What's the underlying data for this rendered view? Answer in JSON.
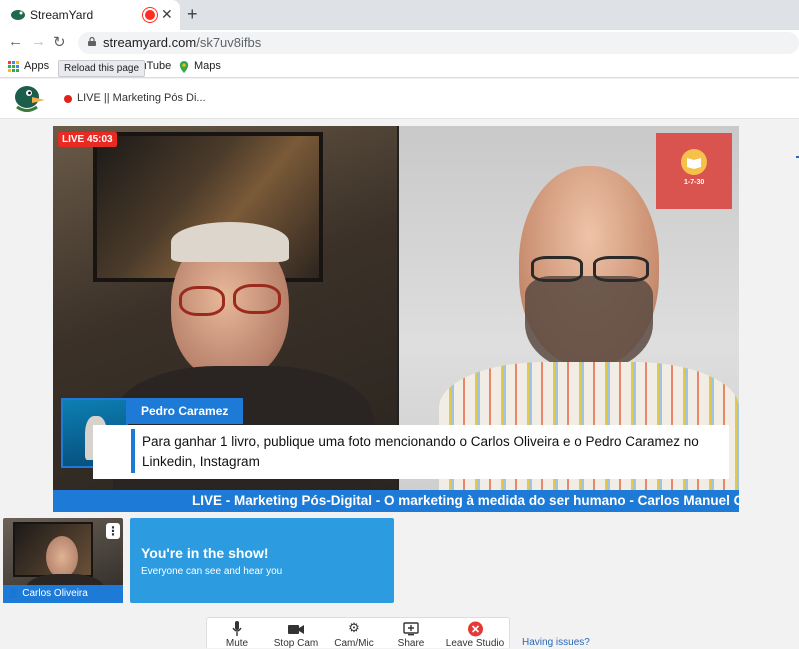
{
  "browser": {
    "tab_title": "StreamYard",
    "url_domain": "streamyard.com",
    "url_path": "/sk7uv8ifbs",
    "bookmarks": [
      "Apps",
      "YouTube",
      "Maps"
    ],
    "tooltip": "Reload this page"
  },
  "header": {
    "stream_title": "LIVE || Marketing Pós Di..."
  },
  "stage": {
    "live_badge": "LIVE 45:03",
    "logo_text": "1-7-30",
    "name_tag": "Pedro Caramez",
    "caption": "Para ganhar 1 livro, publique uma foto mencionando o Carlos Oliveira e o Pedro Caramez no Linkedin, Instagram",
    "ticker": "LIVE - Marketing Pós-Digital - O marketing à medida do ser humano - Carlos Manuel C"
  },
  "self_view": {
    "name": "Carlos Oliveira",
    "more_label": "⋮"
  },
  "notice": {
    "heading": "You're in the show!",
    "subtext": "Everyone can see and hear you"
  },
  "toolbar": {
    "mute": "Mute",
    "stop_cam": "Stop Cam",
    "cam_mic": "Cam/Mic",
    "share": "Share",
    "leave": "Leave Studio"
  },
  "help_link": "Having issues?",
  "colors": {
    "brand_blue": "#1e7ad7",
    "live_red": "#e82a23",
    "notice_blue": "#2d9be0"
  }
}
